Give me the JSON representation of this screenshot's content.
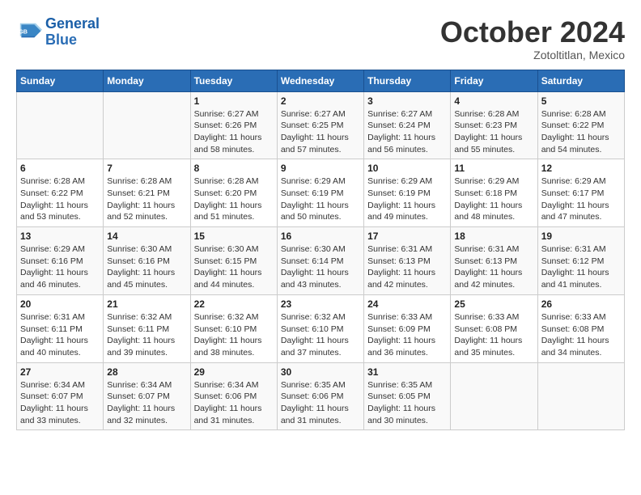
{
  "header": {
    "logo_line1": "General",
    "logo_line2": "Blue",
    "month": "October 2024",
    "location": "Zotoltitlan, Mexico"
  },
  "days_of_week": [
    "Sunday",
    "Monday",
    "Tuesday",
    "Wednesday",
    "Thursday",
    "Friday",
    "Saturday"
  ],
  "weeks": [
    [
      {
        "num": "",
        "sunrise": "",
        "sunset": "",
        "daylight": ""
      },
      {
        "num": "",
        "sunrise": "",
        "sunset": "",
        "daylight": ""
      },
      {
        "num": "1",
        "sunrise": "Sunrise: 6:27 AM",
        "sunset": "Sunset: 6:26 PM",
        "daylight": "Daylight: 11 hours and 58 minutes."
      },
      {
        "num": "2",
        "sunrise": "Sunrise: 6:27 AM",
        "sunset": "Sunset: 6:25 PM",
        "daylight": "Daylight: 11 hours and 57 minutes."
      },
      {
        "num": "3",
        "sunrise": "Sunrise: 6:27 AM",
        "sunset": "Sunset: 6:24 PM",
        "daylight": "Daylight: 11 hours and 56 minutes."
      },
      {
        "num": "4",
        "sunrise": "Sunrise: 6:28 AM",
        "sunset": "Sunset: 6:23 PM",
        "daylight": "Daylight: 11 hours and 55 minutes."
      },
      {
        "num": "5",
        "sunrise": "Sunrise: 6:28 AM",
        "sunset": "Sunset: 6:22 PM",
        "daylight": "Daylight: 11 hours and 54 minutes."
      }
    ],
    [
      {
        "num": "6",
        "sunrise": "Sunrise: 6:28 AM",
        "sunset": "Sunset: 6:22 PM",
        "daylight": "Daylight: 11 hours and 53 minutes."
      },
      {
        "num": "7",
        "sunrise": "Sunrise: 6:28 AM",
        "sunset": "Sunset: 6:21 PM",
        "daylight": "Daylight: 11 hours and 52 minutes."
      },
      {
        "num": "8",
        "sunrise": "Sunrise: 6:28 AM",
        "sunset": "Sunset: 6:20 PM",
        "daylight": "Daylight: 11 hours and 51 minutes."
      },
      {
        "num": "9",
        "sunrise": "Sunrise: 6:29 AM",
        "sunset": "Sunset: 6:19 PM",
        "daylight": "Daylight: 11 hours and 50 minutes."
      },
      {
        "num": "10",
        "sunrise": "Sunrise: 6:29 AM",
        "sunset": "Sunset: 6:19 PM",
        "daylight": "Daylight: 11 hours and 49 minutes."
      },
      {
        "num": "11",
        "sunrise": "Sunrise: 6:29 AM",
        "sunset": "Sunset: 6:18 PM",
        "daylight": "Daylight: 11 hours and 48 minutes."
      },
      {
        "num": "12",
        "sunrise": "Sunrise: 6:29 AM",
        "sunset": "Sunset: 6:17 PM",
        "daylight": "Daylight: 11 hours and 47 minutes."
      }
    ],
    [
      {
        "num": "13",
        "sunrise": "Sunrise: 6:29 AM",
        "sunset": "Sunset: 6:16 PM",
        "daylight": "Daylight: 11 hours and 46 minutes."
      },
      {
        "num": "14",
        "sunrise": "Sunrise: 6:30 AM",
        "sunset": "Sunset: 6:16 PM",
        "daylight": "Daylight: 11 hours and 45 minutes."
      },
      {
        "num": "15",
        "sunrise": "Sunrise: 6:30 AM",
        "sunset": "Sunset: 6:15 PM",
        "daylight": "Daylight: 11 hours and 44 minutes."
      },
      {
        "num": "16",
        "sunrise": "Sunrise: 6:30 AM",
        "sunset": "Sunset: 6:14 PM",
        "daylight": "Daylight: 11 hours and 43 minutes."
      },
      {
        "num": "17",
        "sunrise": "Sunrise: 6:31 AM",
        "sunset": "Sunset: 6:13 PM",
        "daylight": "Daylight: 11 hours and 42 minutes."
      },
      {
        "num": "18",
        "sunrise": "Sunrise: 6:31 AM",
        "sunset": "Sunset: 6:13 PM",
        "daylight": "Daylight: 11 hours and 42 minutes."
      },
      {
        "num": "19",
        "sunrise": "Sunrise: 6:31 AM",
        "sunset": "Sunset: 6:12 PM",
        "daylight": "Daylight: 11 hours and 41 minutes."
      }
    ],
    [
      {
        "num": "20",
        "sunrise": "Sunrise: 6:31 AM",
        "sunset": "Sunset: 6:11 PM",
        "daylight": "Daylight: 11 hours and 40 minutes."
      },
      {
        "num": "21",
        "sunrise": "Sunrise: 6:32 AM",
        "sunset": "Sunset: 6:11 PM",
        "daylight": "Daylight: 11 hours and 39 minutes."
      },
      {
        "num": "22",
        "sunrise": "Sunrise: 6:32 AM",
        "sunset": "Sunset: 6:10 PM",
        "daylight": "Daylight: 11 hours and 38 minutes."
      },
      {
        "num": "23",
        "sunrise": "Sunrise: 6:32 AM",
        "sunset": "Sunset: 6:10 PM",
        "daylight": "Daylight: 11 hours and 37 minutes."
      },
      {
        "num": "24",
        "sunrise": "Sunrise: 6:33 AM",
        "sunset": "Sunset: 6:09 PM",
        "daylight": "Daylight: 11 hours and 36 minutes."
      },
      {
        "num": "25",
        "sunrise": "Sunrise: 6:33 AM",
        "sunset": "Sunset: 6:08 PM",
        "daylight": "Daylight: 11 hours and 35 minutes."
      },
      {
        "num": "26",
        "sunrise": "Sunrise: 6:33 AM",
        "sunset": "Sunset: 6:08 PM",
        "daylight": "Daylight: 11 hours and 34 minutes."
      }
    ],
    [
      {
        "num": "27",
        "sunrise": "Sunrise: 6:34 AM",
        "sunset": "Sunset: 6:07 PM",
        "daylight": "Daylight: 11 hours and 33 minutes."
      },
      {
        "num": "28",
        "sunrise": "Sunrise: 6:34 AM",
        "sunset": "Sunset: 6:07 PM",
        "daylight": "Daylight: 11 hours and 32 minutes."
      },
      {
        "num": "29",
        "sunrise": "Sunrise: 6:34 AM",
        "sunset": "Sunset: 6:06 PM",
        "daylight": "Daylight: 11 hours and 31 minutes."
      },
      {
        "num": "30",
        "sunrise": "Sunrise: 6:35 AM",
        "sunset": "Sunset: 6:06 PM",
        "daylight": "Daylight: 11 hours and 31 minutes."
      },
      {
        "num": "31",
        "sunrise": "Sunrise: 6:35 AM",
        "sunset": "Sunset: 6:05 PM",
        "daylight": "Daylight: 11 hours and 30 minutes."
      },
      {
        "num": "",
        "sunrise": "",
        "sunset": "",
        "daylight": ""
      },
      {
        "num": "",
        "sunrise": "",
        "sunset": "",
        "daylight": ""
      }
    ]
  ]
}
